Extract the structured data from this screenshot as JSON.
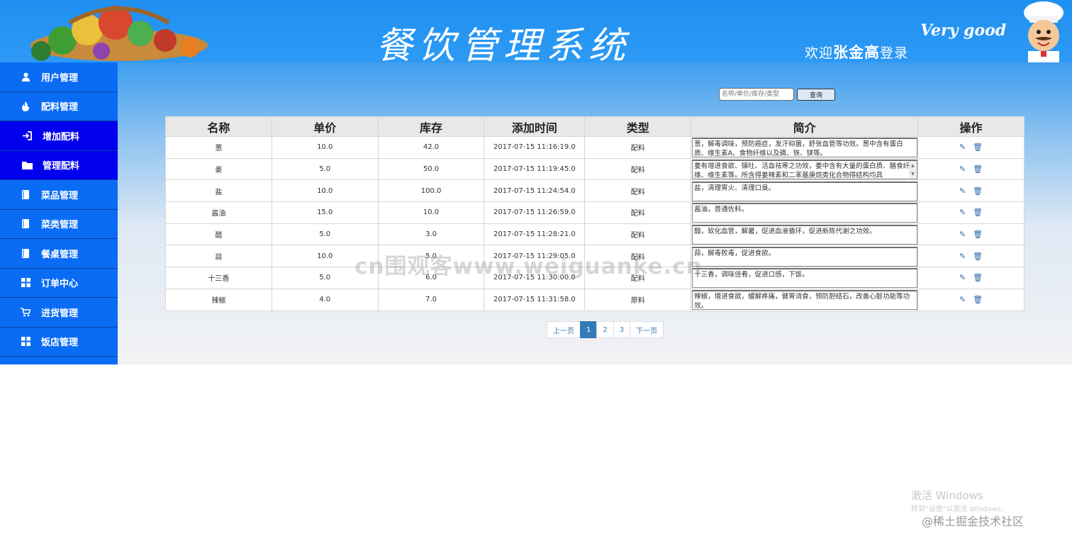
{
  "header": {
    "title": "餐饮管理系统",
    "welcome_prefix": "欢迎",
    "username": "张金高",
    "welcome_suffix": "登录",
    "slogan": "Very good"
  },
  "sidebar": {
    "items": [
      {
        "label": "用户管理",
        "icon": "user-icon"
      },
      {
        "label": "配料管理",
        "icon": "fire-icon"
      },
      {
        "label": "增加配料",
        "icon": "login-icon"
      },
      {
        "label": "管理配料",
        "icon": "folder-icon"
      },
      {
        "label": "菜品管理",
        "icon": "book-icon"
      },
      {
        "label": "菜类管理",
        "icon": "book-icon"
      },
      {
        "label": "餐桌管理",
        "icon": "book-icon"
      },
      {
        "label": "订单中心",
        "icon": "grid-icon"
      },
      {
        "label": "进货管理",
        "icon": "cart-icon"
      },
      {
        "label": "饭店管理",
        "icon": "grid-icon"
      }
    ]
  },
  "search": {
    "placeholder": "名称/单价/库存/类型",
    "button_label": "查询"
  },
  "table": {
    "columns": [
      "名称",
      "单价",
      "库存",
      "添加时间",
      "类型",
      "简介",
      "操作"
    ],
    "rows": [
      {
        "name": "葱",
        "price": "10.0",
        "stock": "42.0",
        "time": "2017-07-15 11:16:19.0",
        "type": "配料",
        "desc": "葱，解毒调味，预防癌症，发汗抑菌，舒张血管等功效。葱中含有蛋白质、维生素A、食物纤维以及磷、铁、镁等。"
      },
      {
        "name": "姜",
        "price": "5.0",
        "stock": "50.0",
        "time": "2017-07-15 11:19:45.0",
        "type": "配料",
        "desc": "姜有增进食欲、镇吐、活血祛寒之功效，姜中含有大量的蛋白质、膳食纤维、维生素等。所含得姜辣素和二苯基庚烷类化合物得结构均具"
      },
      {
        "name": "盐",
        "price": "10.0",
        "stock": "100.0",
        "time": "2017-07-15 11:24:54.0",
        "type": "配料",
        "desc": "盐，清理胃火、清理口臭。"
      },
      {
        "name": "酱油",
        "price": "15.0",
        "stock": "10.0",
        "time": "2017-07-15 11:26:59.0",
        "type": "配料",
        "desc": "酱油，普通佐料。"
      },
      {
        "name": "醋",
        "price": "5.0",
        "stock": "3.0",
        "time": "2017-07-15 11:28:21.0",
        "type": "配料",
        "desc": "醋，软化血管，解暑，促进血液循环，促进新陈代谢之功效。"
      },
      {
        "name": "蒜",
        "price": "10.0",
        "stock": "5.0",
        "time": "2017-07-15 11:29:05.0",
        "type": "配料",
        "desc": "蒜，解毒败毒，促进食欲。"
      },
      {
        "name": "十三香",
        "price": "5.0",
        "stock": "6.0",
        "time": "2017-07-15 11:30:00.0",
        "type": "配料",
        "desc": "十三香，调味佳肴，促进口感，下饭。"
      },
      {
        "name": "辣椒",
        "price": "4.0",
        "stock": "7.0",
        "time": "2017-07-15 11:31:58.0",
        "type": "原料",
        "desc": "辣椒，增进食欲，缓解疼痛，健胃消食，预防胆结石，改善心脏功能等功效。"
      }
    ]
  },
  "pagination": {
    "prev": "上一页",
    "pages": [
      "1",
      "2",
      "3"
    ],
    "next": "下一页",
    "current": "1"
  },
  "watermarks": {
    "center": "cn围观客www.weiguanke.cn",
    "windows_title": "激活 Windows",
    "windows_sub": "转到\"设置\"以激活 Windows。",
    "juejin": "@稀土掘金技术社区"
  },
  "colors": {
    "header_blue": "#1f8ff0",
    "sidebar_blue": "#0a6cf5",
    "sidebar_active": "#0000ee",
    "page_active": "#337ab7"
  }
}
